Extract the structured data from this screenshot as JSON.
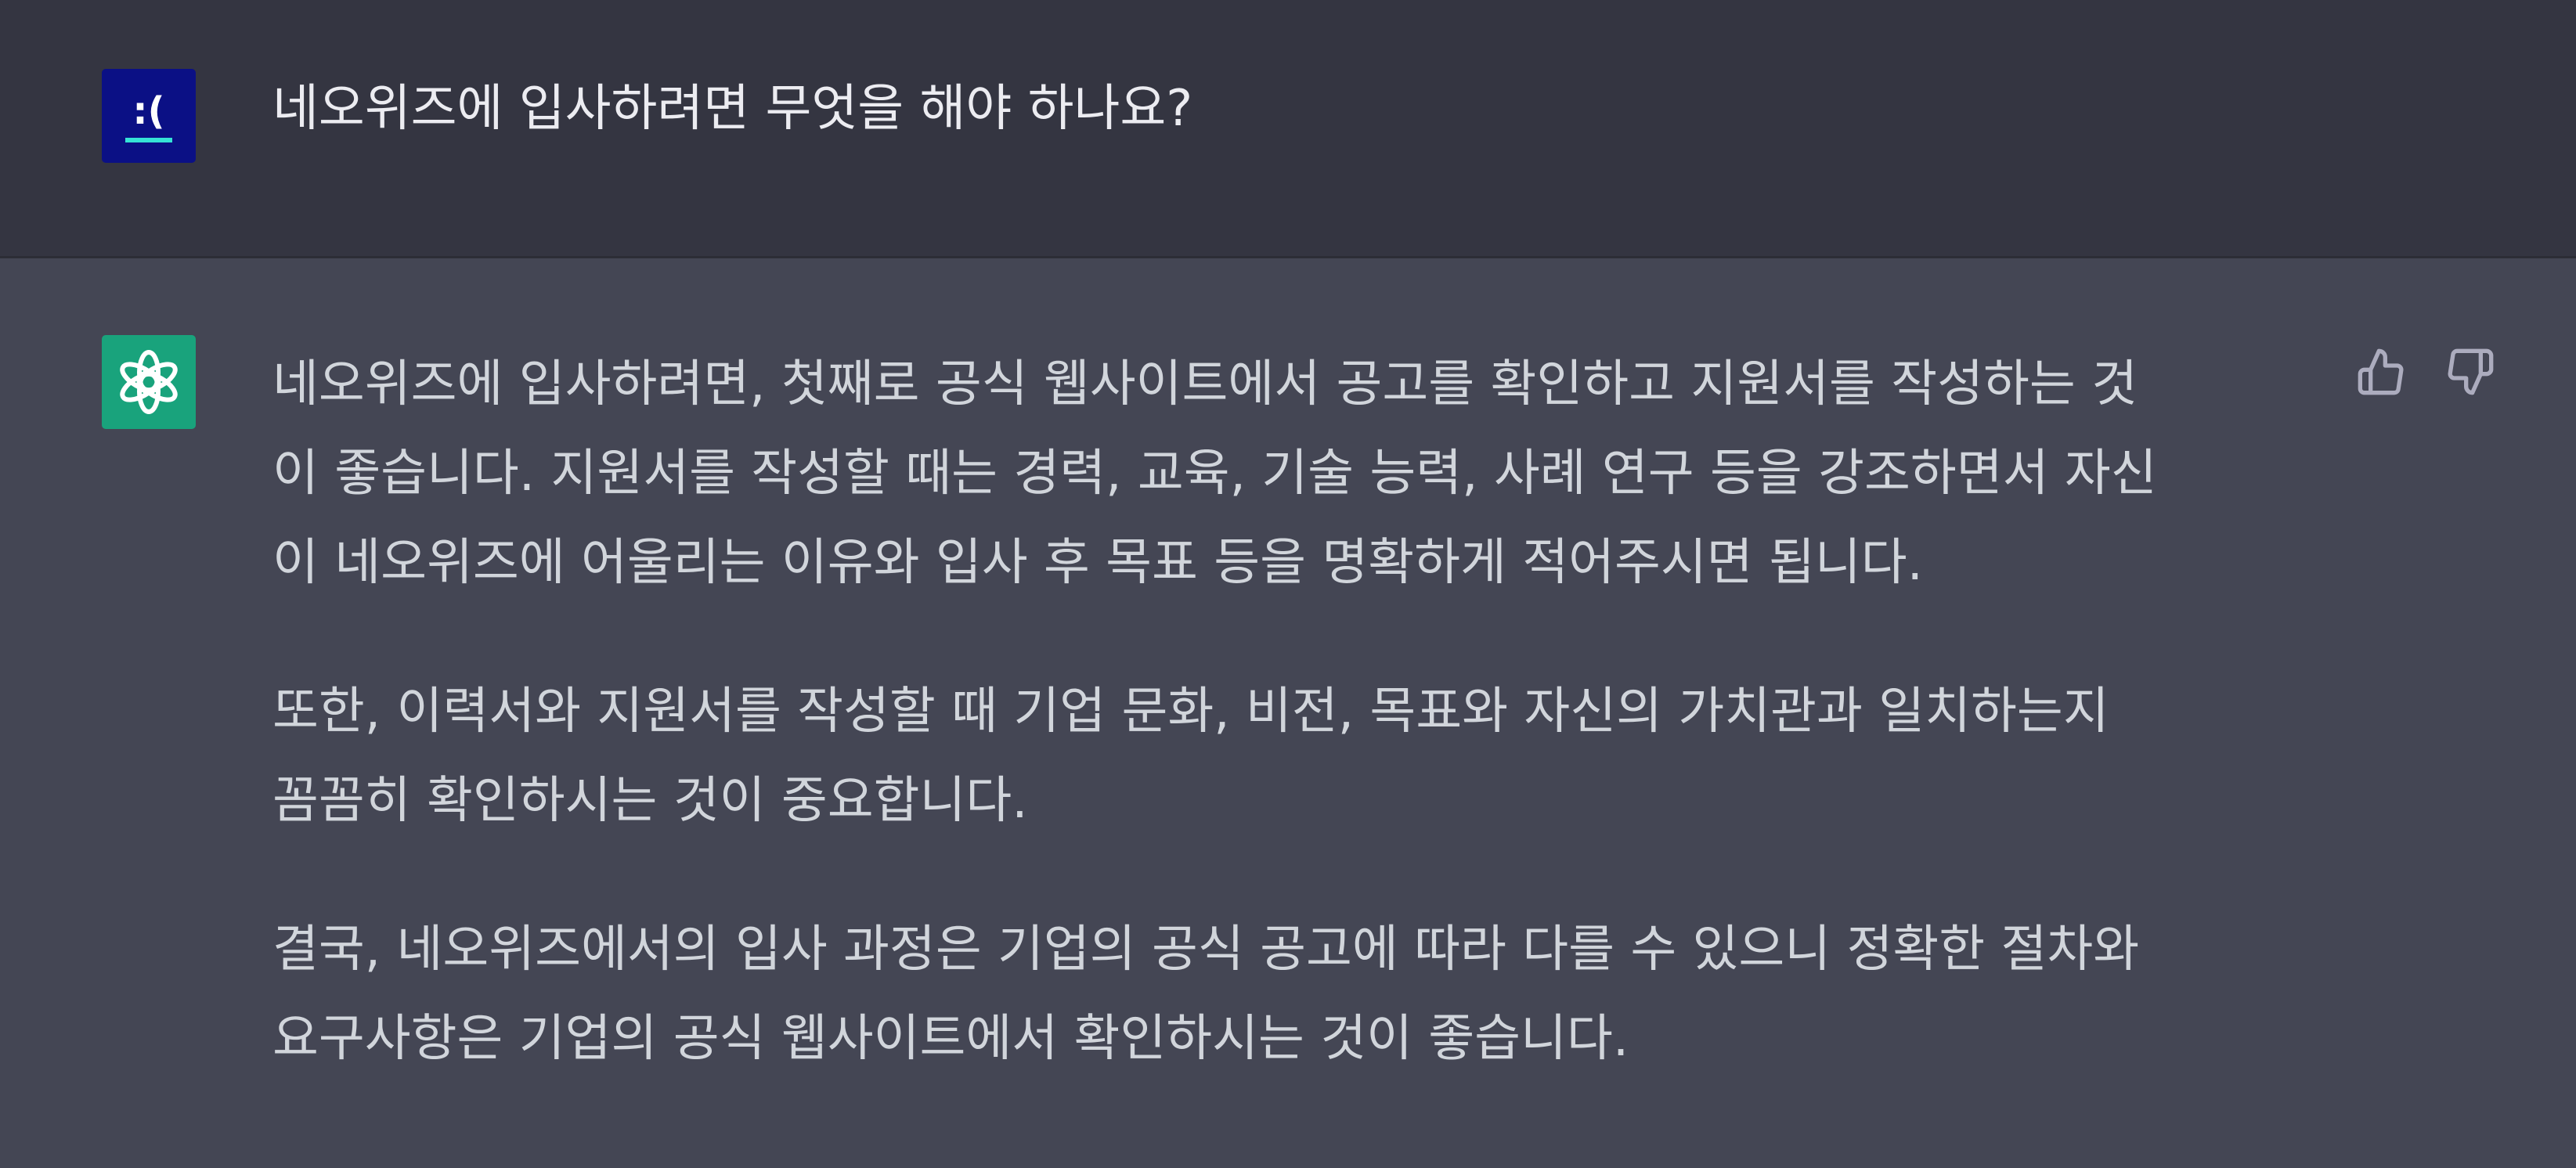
{
  "user": {
    "avatar_text": ":(",
    "message": "네오위즈에 입사하려면 무엇을 해야 하나요?"
  },
  "assistant": {
    "avatar_icon": "openai-logo-icon",
    "paragraphs": [
      {
        "lines": [
          "네오위즈에 입사하려면, 첫째로 공식 웹사이트에서 공고를 확인하고 지원서를 작성하는 것",
          "이 좋습니다. 지원서를 작성할 때는 경력, 교육, 기술 능력, 사례 연구 등을 강조하면서 자신",
          "이 네오위즈에 어울리는 이유와 입사 후 목표 등을 명확하게 적어주시면 됩니다."
        ]
      },
      {
        "lines": [
          "또한, 이력서와 지원서를 작성할 때 기업 문화, 비전, 목표와 자신의 가치관과 일치하는지",
          "꼼꼼히 확인하시는 것이 중요합니다."
        ]
      },
      {
        "lines": [
          "결국, 네오위즈에서의 입사 과정은 기업의 공식 공고에 따라 다를 수 있으니 정확한 절차와",
          "요구사항은 기업의 공식 웹사이트에서 확인하시는 것이 좋습니다."
        ]
      }
    ],
    "feedback": {
      "thumbs_up_icon": "thumbs-up-icon",
      "thumbs_down_icon": "thumbs-down-icon"
    }
  },
  "colors": {
    "user_bg": "#343541",
    "assistant_bg": "#444654",
    "user_avatar_bg": "#0b1085",
    "bot_avatar_bg": "#19a37c",
    "text": "#d1d5db"
  }
}
